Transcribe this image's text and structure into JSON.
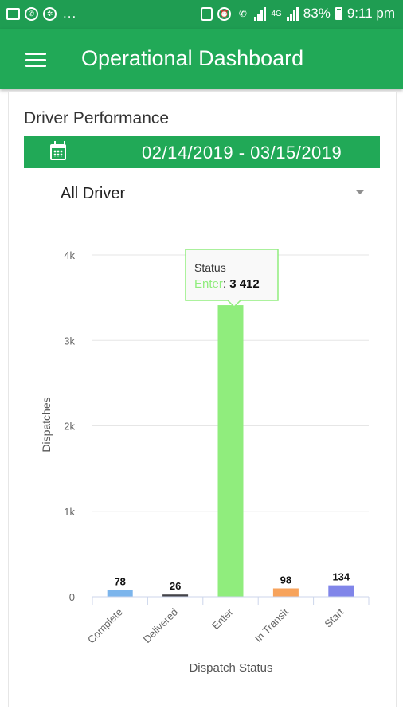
{
  "status_bar": {
    "dots": "...",
    "battery": "83%",
    "time": "9:11 pm",
    "network": "4G"
  },
  "app_bar": {
    "title": "Operational Dashboard"
  },
  "driver_performance": {
    "title": "Driver Performance",
    "date_range": "02/14/2019 - 03/15/2019",
    "driver_filter": "All Driver"
  },
  "tooltip": {
    "title": "Status",
    "series": "Enter",
    "value": "3 412"
  },
  "chart_data": {
    "type": "bar",
    "xlabel": "Dispatch Status",
    "ylabel": "Dispatches",
    "ylim": [
      0,
      4000
    ],
    "yticks": [
      "0",
      "1k",
      "2k",
      "3k",
      "4k"
    ],
    "categories": [
      "Complete",
      "Delivered",
      "Enter",
      "In Transit",
      "Start"
    ],
    "values": [
      78,
      26,
      3412,
      98,
      134
    ],
    "colors": [
      "#7cb5ec",
      "#434348",
      "#90ed7d",
      "#f7a35c",
      "#8085e9"
    ],
    "grid": true
  }
}
